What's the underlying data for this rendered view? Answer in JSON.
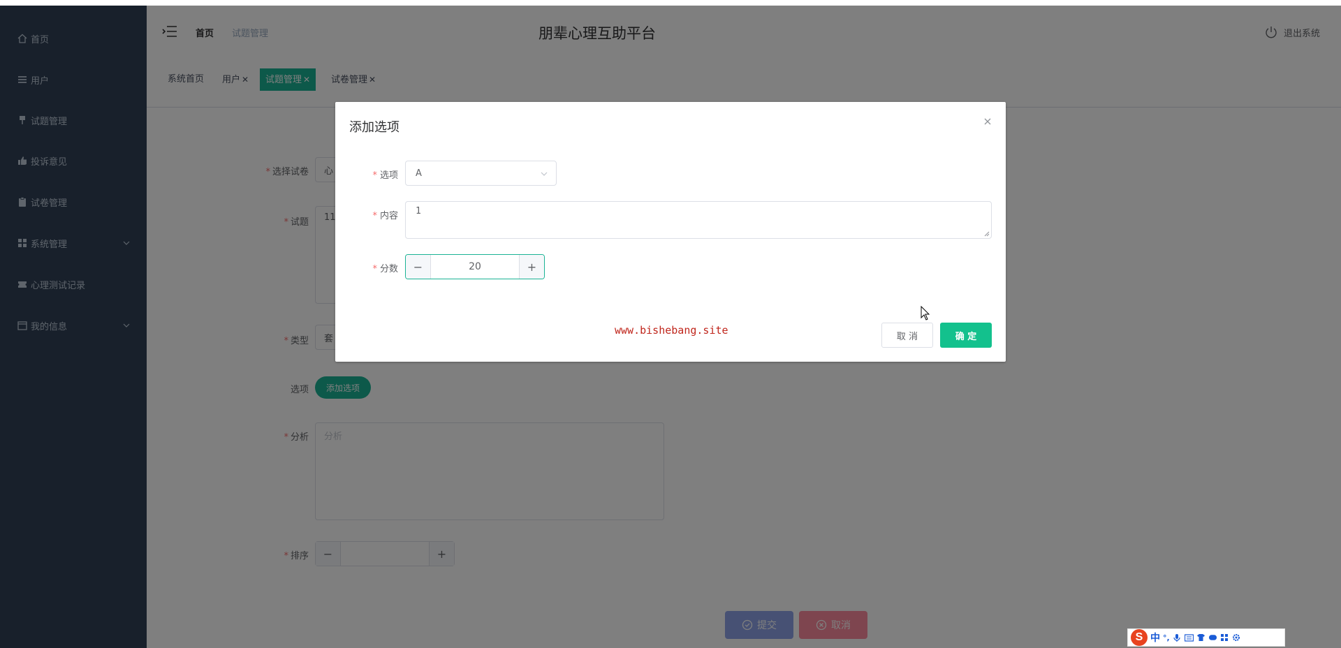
{
  "sidebar": {
    "items": [
      {
        "label": "首页",
        "icon": "home-icon"
      },
      {
        "label": "用户",
        "icon": "list-icon"
      },
      {
        "label": "试题管理",
        "icon": "pin-icon"
      },
      {
        "label": "投诉意见",
        "icon": "thumb-icon"
      },
      {
        "label": "试卷管理",
        "icon": "clipboard-icon"
      },
      {
        "label": "系统管理",
        "icon": "grid-icon",
        "has_submenu": true
      },
      {
        "label": "心理测试记录",
        "icon": "ticket-icon"
      },
      {
        "label": "我的信息",
        "icon": "calendar-icon",
        "has_submenu": true
      }
    ]
  },
  "header": {
    "breadcrumb_home": "首页",
    "breadcrumb_current": "试题管理",
    "title": "朋辈心理互助平台",
    "logout_label": "退出系统"
  },
  "tags": [
    {
      "label": "系统首页",
      "closable": false,
      "active": false
    },
    {
      "label": "用户",
      "closable": true,
      "active": false
    },
    {
      "label": "试题管理",
      "closable": true,
      "active": true
    },
    {
      "label": "试卷管理",
      "closable": true,
      "active": false
    }
  ],
  "form": {
    "paper_label": "选择试卷",
    "paper_value": "心",
    "question_label": "试题",
    "question_value": "11",
    "type_label": "类型",
    "type_value": "套",
    "options_label": "选项",
    "add_option_label": "添加选项",
    "analysis_label": "分析",
    "analysis_placeholder": "分析",
    "sort_label": "排序",
    "submit_label": "提交",
    "cancel_label": "取消"
  },
  "dialog": {
    "title": "添加选项",
    "option_label": "选项",
    "option_value": "A",
    "content_label": "内容",
    "content_value": "1",
    "score_label": "分数",
    "score_value": "20",
    "watermark": "www.bishebang.site",
    "cancel_label": "取 消",
    "confirm_label": "确 定"
  },
  "ime": {
    "mode": "中",
    "punct": "°,"
  },
  "colors": {
    "sidebar_bg": "#304156",
    "accent": "#1ab394",
    "confirm": "#13c18d",
    "required": "#f56c6c",
    "watermark": "#c0261c"
  }
}
